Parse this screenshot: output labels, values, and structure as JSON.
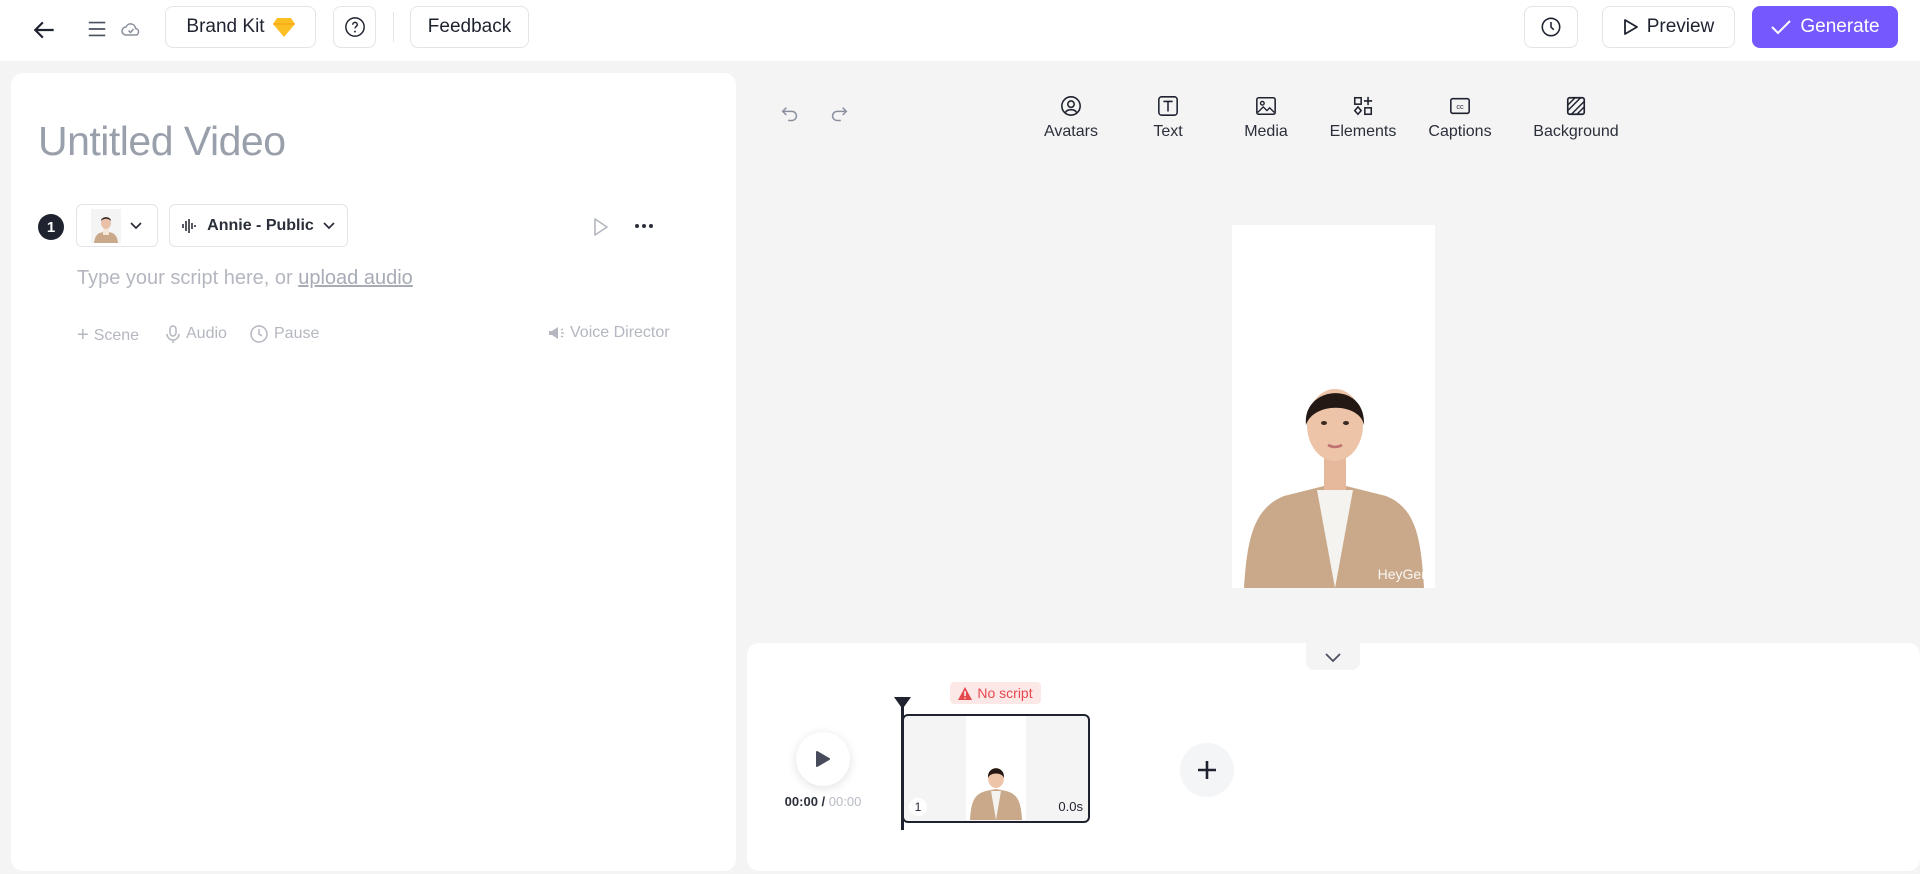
{
  "topbar": {
    "brand_kit": "Brand Kit",
    "feedback": "Feedback",
    "preview": "Preview",
    "generate": "Generate"
  },
  "editor": {
    "title": "Untitled Video",
    "scene_number": "1",
    "voice": "Annie - Public",
    "placeholder": "Type your script here, or ",
    "upload_link": "upload audio",
    "actions": {
      "scene": "Scene",
      "audio": "Audio",
      "pause": "Pause",
      "voice_director": "Voice Director"
    }
  },
  "toolbar": {
    "items": [
      "Avatars",
      "Text",
      "Media",
      "Elements",
      "Captions",
      "Background"
    ]
  },
  "canvas": {
    "watermark": "HeyGen"
  },
  "timeline": {
    "current_time": "00:00",
    "total_time": "00:00",
    "warning": "No script",
    "clip_number": "1",
    "clip_duration": "0.0s"
  },
  "colors": {
    "accent": "#7559ff",
    "warning": "#e5484d"
  }
}
